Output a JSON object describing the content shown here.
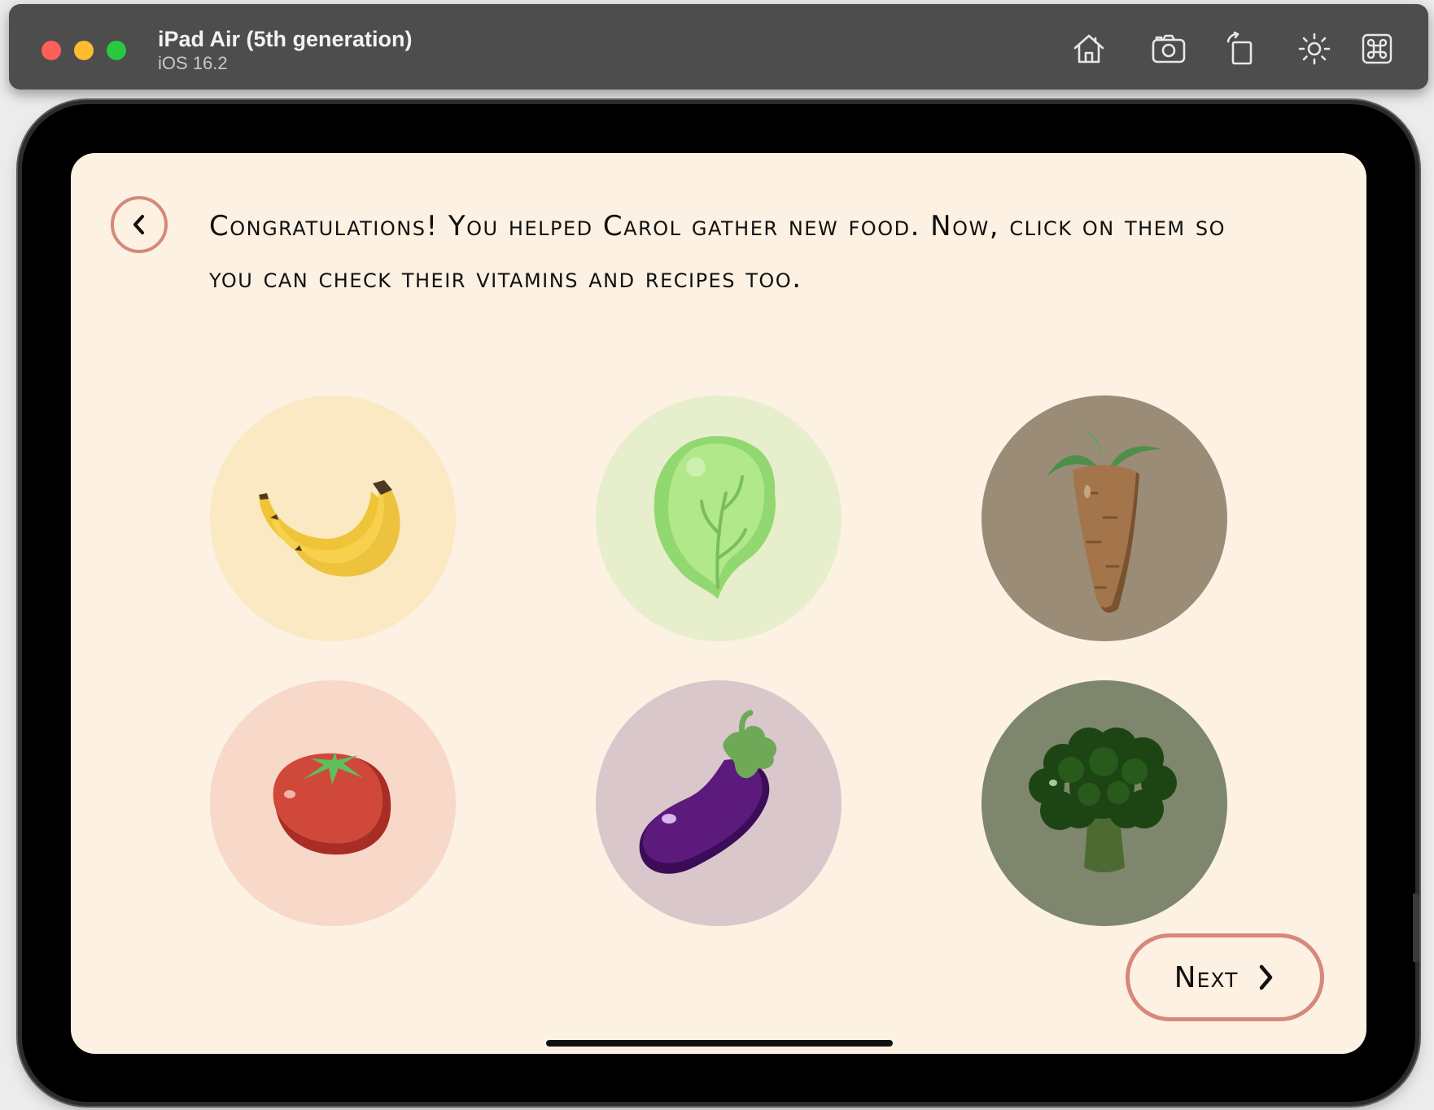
{
  "simulator": {
    "device_name": "iPad Air (5th generation)",
    "os_version": "iOS 16.2",
    "toolbar_icons": [
      "home-icon",
      "screenshot-icon",
      "rotate-icon",
      "appearance-icon",
      "command-icon"
    ]
  },
  "screen": {
    "message": "Congratulations! You helped Carol gather new food. Now, click on them so you can check their vitamins and recipes too.",
    "back_icon": "chevron-left-icon",
    "next_label": "Next",
    "next_icon": "chevron-right-icon"
  },
  "foods": [
    {
      "name": "banana",
      "bg": "#fae9c2"
    },
    {
      "name": "lettuce",
      "bg": "#e7eecb"
    },
    {
      "name": "carrot",
      "bg": "#9a8c77"
    },
    {
      "name": "tomato",
      "bg": "#f7d8c9"
    },
    {
      "name": "eggplant",
      "bg": "#dac7cb"
    },
    {
      "name": "broccoli",
      "bg": "#7e876d"
    }
  ],
  "colors": {
    "screen_bg": "#fcf1e2",
    "accent_border": "#d5887b",
    "titlebar_bg": "#4d4d4d"
  }
}
